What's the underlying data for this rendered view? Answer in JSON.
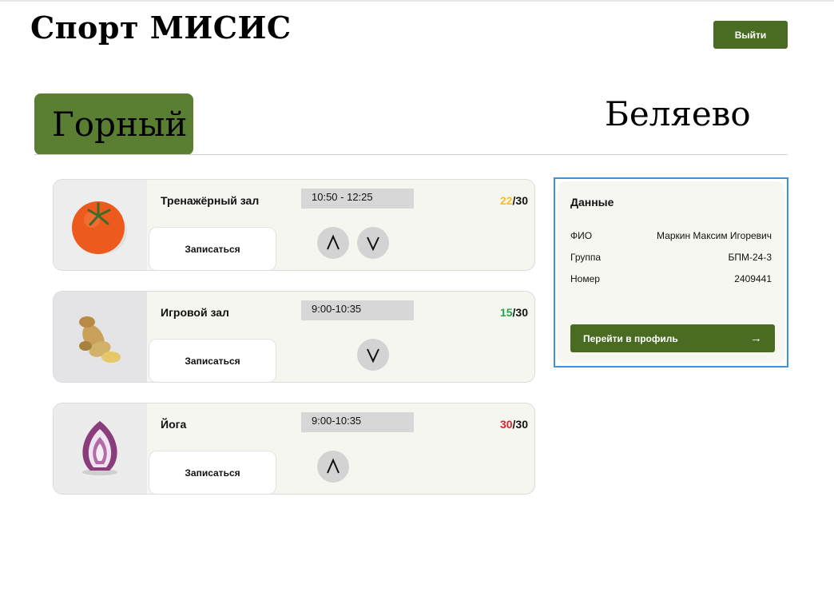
{
  "header": {
    "brand": "Спорт МИСИС",
    "logout_label": "Выйти"
  },
  "tabs": [
    {
      "label": "Горный",
      "active": true
    },
    {
      "label": "Беляево",
      "active": false
    }
  ],
  "classes": [
    {
      "image": "tomato",
      "title": "Тренажёрный зал",
      "time": "10:50 - 12:25",
      "booked": "22",
      "separator_capacity": "/30",
      "booked_color": "#f2c21b",
      "signup_label": "Записаться",
      "controls": [
        "up-chevron-icon",
        "down-chevron-icon"
      ]
    },
    {
      "image": "ginger",
      "title": "Игровой зал",
      "time": "9:00-10:35",
      "booked": "15",
      "separator_capacity": "/30",
      "booked_color": "#22a34a",
      "signup_label": "Записаться",
      "controls": [
        "down-chevron-icon"
      ]
    },
    {
      "image": "onion",
      "title": "Йога",
      "time": "9:00-10:35",
      "booked": "30",
      "separator_capacity": "/30",
      "booked_color": "#d9232e",
      "signup_label": "Записаться",
      "controls": [
        "up-chevron-icon"
      ]
    }
  ],
  "profile": {
    "title": "Данные",
    "rows": [
      {
        "label": "ФИО",
        "value": "Маркин Максим Игоревич"
      },
      {
        "label": "Группа",
        "value": "БПМ-24-3"
      },
      {
        "label": "Номер",
        "value": "2409441"
      }
    ],
    "button_label": "Перейти в профиль",
    "button_icon": "arrow-right-icon"
  },
  "colors": {
    "accent": "#4a6b22",
    "tab_active": "#5a7f33",
    "panel_border": "#3d93da"
  }
}
